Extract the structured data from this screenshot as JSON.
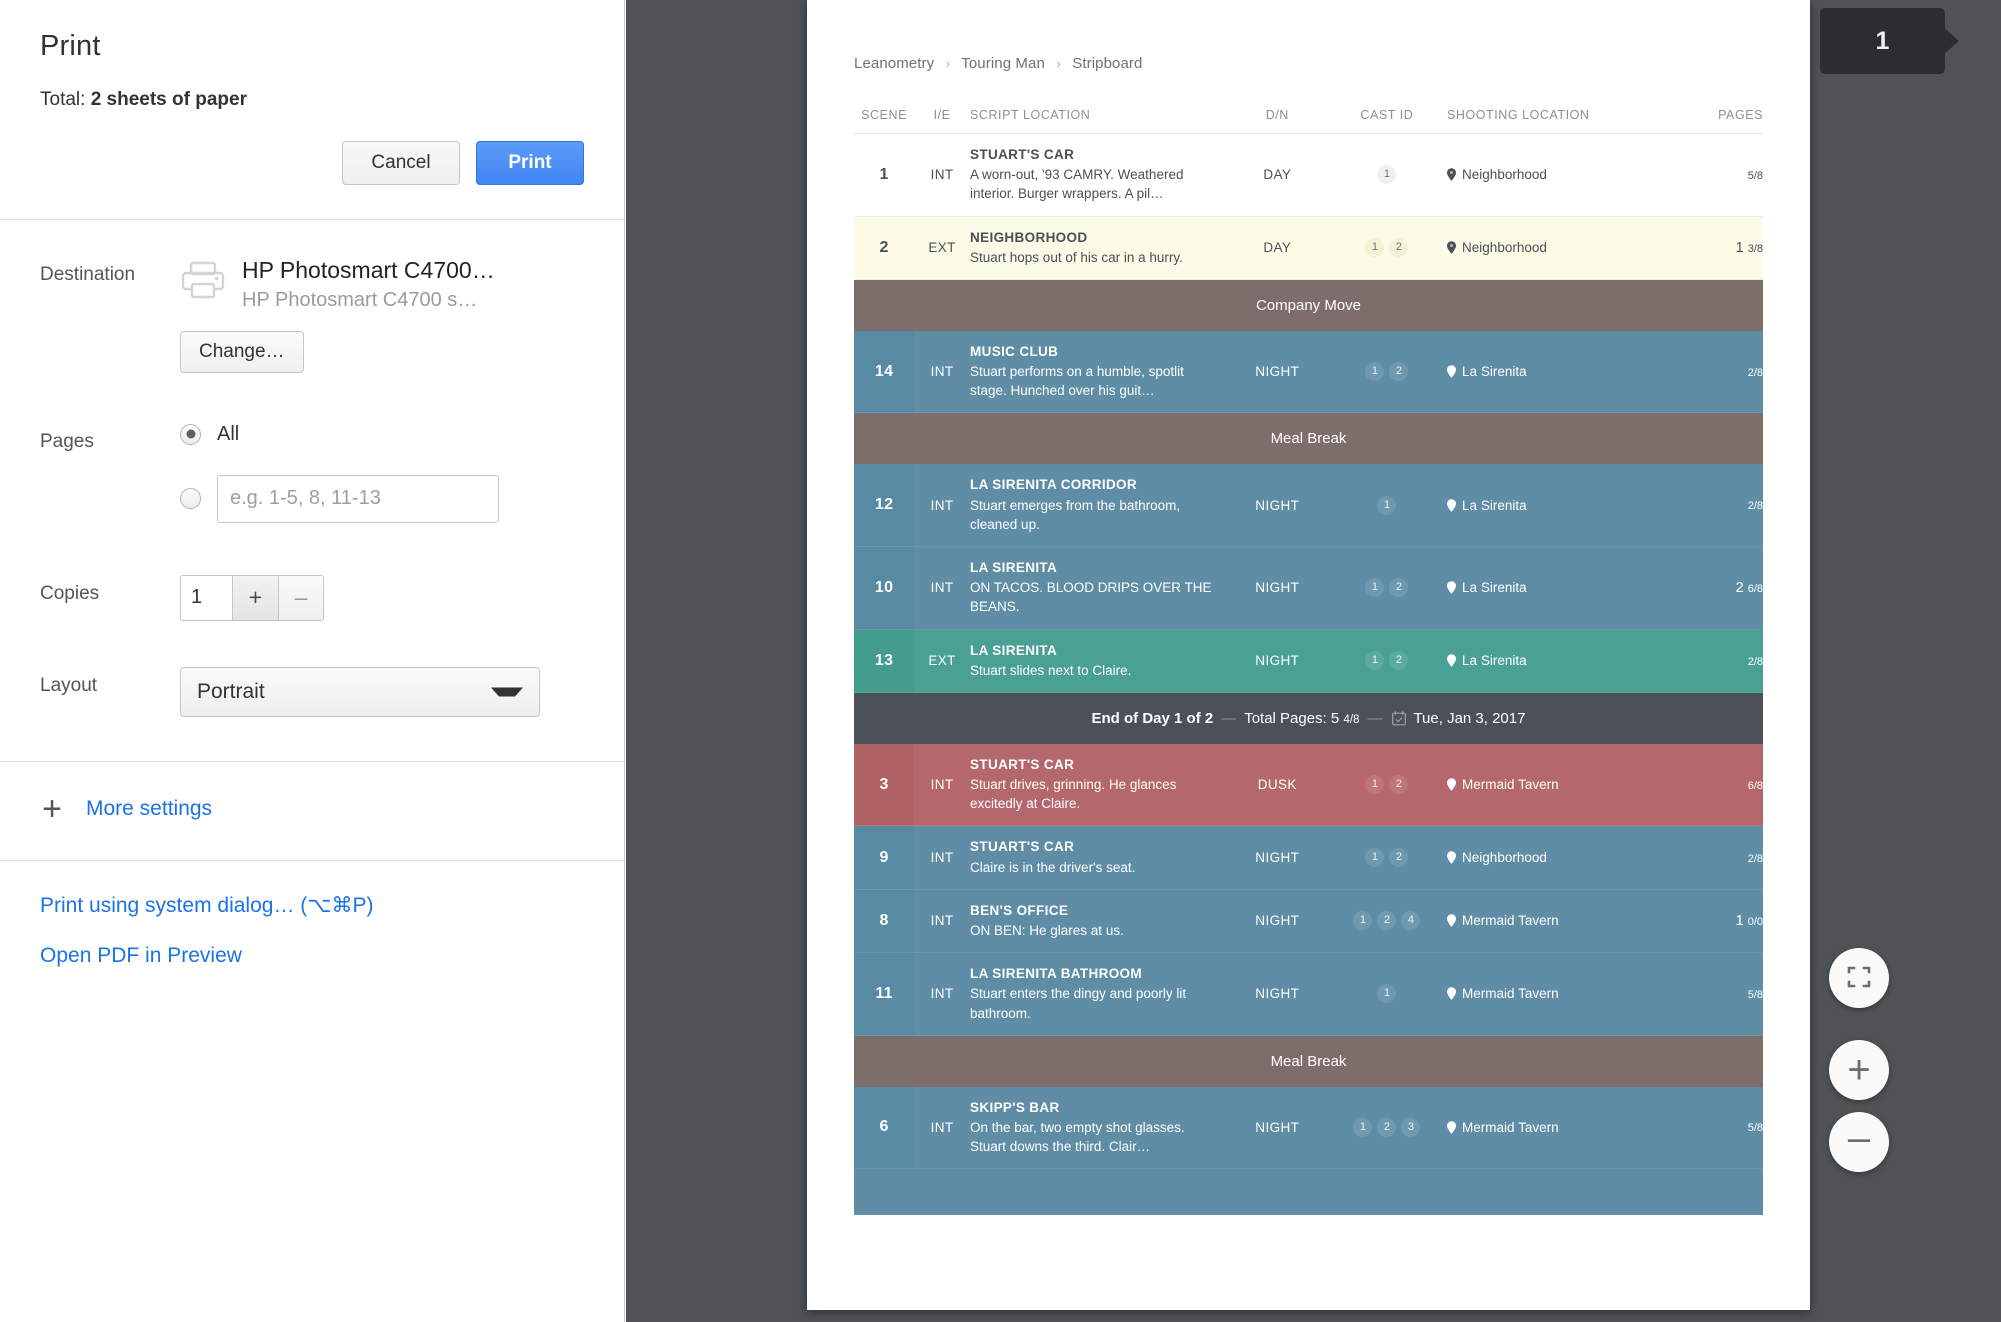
{
  "print_dialog": {
    "title": "Print",
    "total_prefix": "Total: ",
    "total_value": "2 sheets of paper",
    "cancel_label": "Cancel",
    "print_label": "Print",
    "destination_label": "Destination",
    "destination_name": "HP Photosmart C4700…",
    "destination_sub": "HP Photosmart C4700 s…",
    "change_label": "Change…",
    "pages_label": "Pages",
    "pages_all_label": "All",
    "pages_range_placeholder": "e.g. 1-5, 8, 11-13",
    "pages_range_value": "",
    "copies_label": "Copies",
    "copies_value": "1",
    "copies_plus": "+",
    "copies_minus": "–",
    "layout_label": "Layout",
    "layout_value": "Portrait",
    "more_settings_label": "More settings",
    "more_settings_plus": "+",
    "system_dialog_link": "Print using system dialog… (⌥⌘P)",
    "open_pdf_link": "Open PDF in Preview"
  },
  "preview": {
    "page_badge": "1",
    "zoom_fit_label": "",
    "zoom_in_label": "+",
    "zoom_out_label": "–"
  },
  "document": {
    "breadcrumb": [
      "Leanometry",
      "Touring Man",
      "Stripboard"
    ],
    "breadcrumb_separator": "›",
    "columns": [
      "SCENE",
      "I/E",
      "SCRIPT LOCATION",
      "D/N",
      "CAST ID",
      "SHOOTING LOCATION",
      "PAGES"
    ],
    "rows": [
      {
        "kind": "scene",
        "style": "white",
        "scene": "1",
        "ie": "INT",
        "title": "STUART'S CAR",
        "desc": "A worn-out, '93 CAMRY. Weathered interior. Burger wrappers. A pil…",
        "dn": "DAY",
        "cast": [
          "1"
        ],
        "location": "Neighborhood",
        "pages_whole": "",
        "pages_frac": "5/8"
      },
      {
        "kind": "scene",
        "style": "cream",
        "scene": "2",
        "ie": "EXT",
        "title": "NEIGHBORHOOD",
        "desc": "Stuart hops out of his car in a hurry.",
        "dn": "DAY",
        "cast": [
          "1",
          "2"
        ],
        "location": "Neighborhood",
        "pages_whole": "1",
        "pages_frac": "3/8"
      },
      {
        "kind": "banner",
        "style": "break",
        "label": "Company Move"
      },
      {
        "kind": "scene",
        "style": "blue",
        "scene": "14",
        "ie": "INT",
        "title": "MUSIC CLUB",
        "desc": "Stuart performs on a humble, spotlit stage. Hunched over his guit…",
        "dn": "NIGHT",
        "cast": [
          "1",
          "2"
        ],
        "location": "La Sirenita",
        "pages_whole": "",
        "pages_frac": "2/8"
      },
      {
        "kind": "banner",
        "style": "break",
        "label": "Meal Break"
      },
      {
        "kind": "scene",
        "style": "blue",
        "scene": "12",
        "ie": "INT",
        "title": "LA SIRENITA CORRIDOR",
        "desc": "Stuart emerges from the bathroom, cleaned up.",
        "dn": "NIGHT",
        "cast": [
          "1"
        ],
        "location": "La Sirenita",
        "pages_whole": "",
        "pages_frac": "2/8"
      },
      {
        "kind": "scene",
        "style": "blue",
        "scene": "10",
        "ie": "INT",
        "title": "LA SIRENITA",
        "desc": "ON TACOS. BLOOD DRIPS OVER THE BEANS.",
        "dn": "NIGHT",
        "cast": [
          "1",
          "2"
        ],
        "location": "La Sirenita",
        "pages_whole": "2",
        "pages_frac": "6/8"
      },
      {
        "kind": "scene",
        "style": "teal",
        "scene": "13",
        "ie": "EXT",
        "title": "LA SIRENITA",
        "desc": "Stuart slides next to Claire.",
        "dn": "NIGHT",
        "cast": [
          "1",
          "2"
        ],
        "location": "La Sirenita",
        "pages_whole": "",
        "pages_frac": "2/8"
      },
      {
        "kind": "eod",
        "title": "End of Day 1 of 2",
        "total_pages_label": "Total Pages: 5",
        "total_pages_frac": "4/8",
        "date": "Tue, Jan 3, 2017",
        "dash": "—"
      },
      {
        "kind": "scene",
        "style": "red",
        "scene": "3",
        "ie": "INT",
        "title": "STUART'S CAR",
        "desc": "Stuart drives, grinning. He glances excitedly at Claire.",
        "dn": "DUSK",
        "cast": [
          "1",
          "2"
        ],
        "location": "Mermaid Tavern",
        "pages_whole": "",
        "pages_frac": "6/8"
      },
      {
        "kind": "scene",
        "style": "blue",
        "scene": "9",
        "ie": "INT",
        "title": "STUART'S CAR",
        "desc": "Claire is in the driver's seat.",
        "dn": "NIGHT",
        "cast": [
          "1",
          "2"
        ],
        "location": "Neighborhood",
        "pages_whole": "",
        "pages_frac": "2/8"
      },
      {
        "kind": "scene",
        "style": "blue",
        "scene": "8",
        "ie": "INT",
        "title": "BEN'S OFFICE",
        "desc": "ON BEN: He glares at us.",
        "dn": "NIGHT",
        "cast": [
          "1",
          "2",
          "4"
        ],
        "location": "Mermaid Tavern",
        "pages_whole": "1",
        "pages_frac": "0/0"
      },
      {
        "kind": "scene",
        "style": "blue",
        "scene": "11",
        "ie": "INT",
        "title": "LA SIRENITA BATHROOM",
        "desc": "Stuart enters the dingy and poorly lit bathroom.",
        "dn": "NIGHT",
        "cast": [
          "1"
        ],
        "location": "Mermaid Tavern",
        "pages_whole": "",
        "pages_frac": "5/8"
      },
      {
        "kind": "banner",
        "style": "break",
        "label": "Meal Break"
      },
      {
        "kind": "scene",
        "style": "blue",
        "scene": "6",
        "ie": "INT",
        "title": "SKIPP'S BAR",
        "desc": "On the bar, two empty shot glasses. Stuart downs the third. Clair…",
        "dn": "NIGHT",
        "cast": [
          "1",
          "2",
          "3"
        ],
        "location": "Mermaid Tavern",
        "pages_whole": "",
        "pages_frac": "5/8"
      },
      {
        "kind": "partial",
        "style": "blue"
      }
    ]
  },
  "colors": {
    "accent_blue": "#1a73e8",
    "print_button": "#4285f4",
    "row_blue": "#5f8da6",
    "row_teal": "#4ba094",
    "row_red": "#b5686b",
    "row_cream": "#fcfbe6",
    "banner_break": "#7d6e6b",
    "banner_eod": "#4c5158",
    "preview_bg": "#4f5356"
  }
}
